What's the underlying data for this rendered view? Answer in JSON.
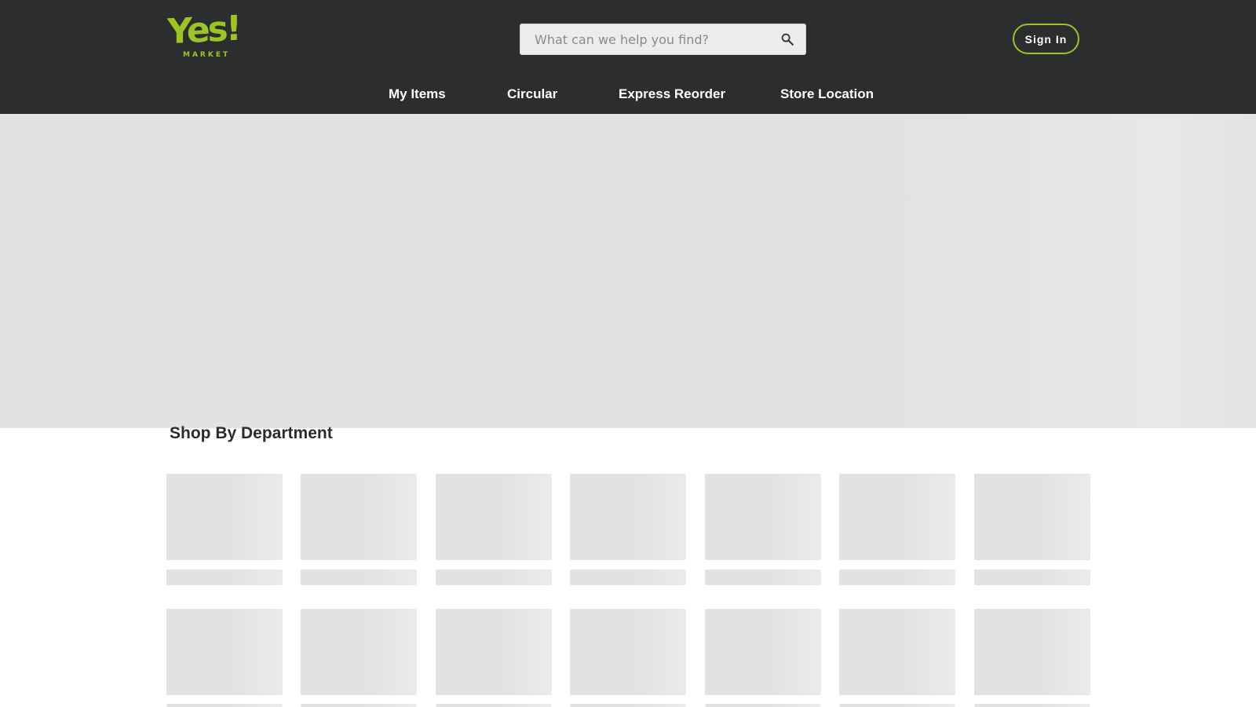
{
  "header": {
    "logo": {
      "word": "Yes!",
      "subtitle": "MARKET"
    },
    "search": {
      "placeholder": "What can we help you find?"
    },
    "sign_in_label": "Sign In",
    "nav": [
      {
        "label": "My Items"
      },
      {
        "label": "Circular"
      },
      {
        "label": "Express Reorder"
      },
      {
        "label": "Store Location"
      }
    ]
  },
  "departments": {
    "title": "Shop By Department"
  },
  "colors": {
    "header_bg": "#2c2d2f",
    "accent": "#9cc423",
    "placeholder_gray": "#e2e2e2"
  },
  "icons": {
    "search": "search-icon"
  }
}
